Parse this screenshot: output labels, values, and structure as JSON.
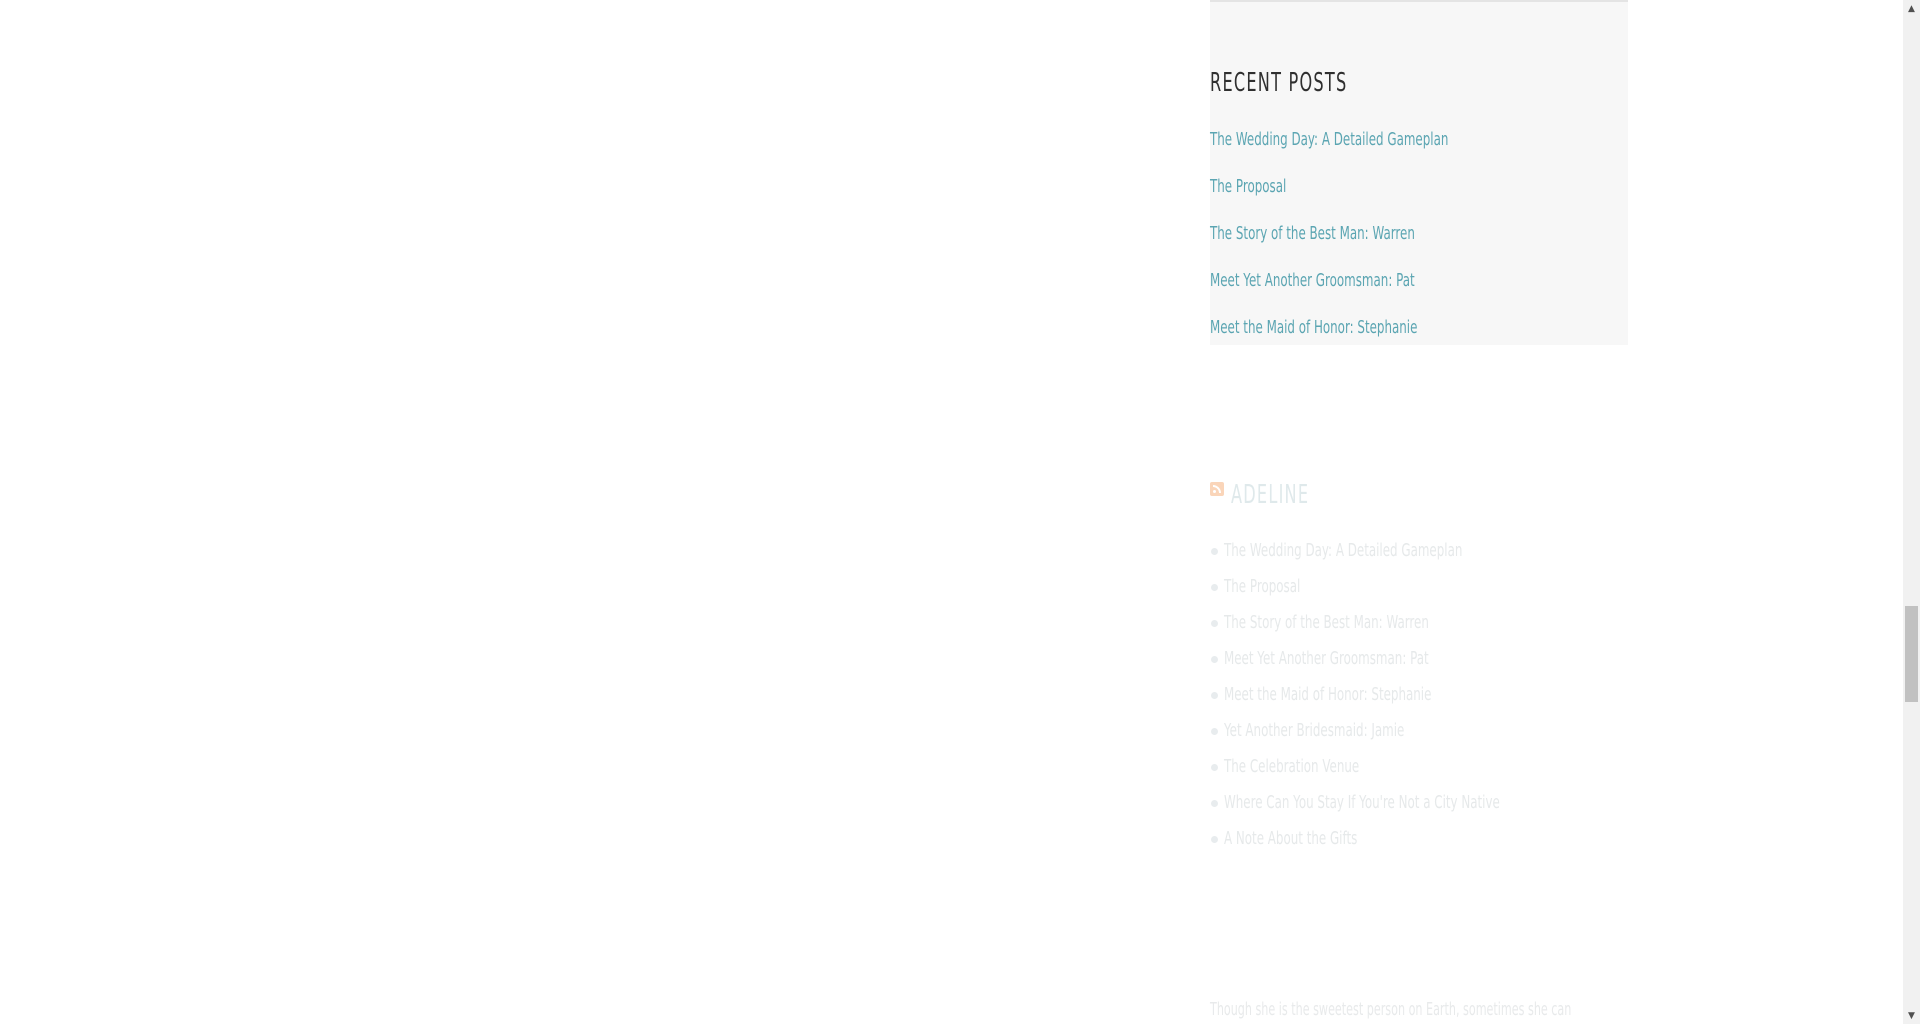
{
  "sidebar": {
    "recent_posts": {
      "title": "RECENT POSTS",
      "items": [
        {
          "label": "The Wedding Day: A Detailed Gameplan"
        },
        {
          "label": "The Proposal"
        },
        {
          "label": "The Story of the Best Man: Warren"
        },
        {
          "label": "Meet Yet Another Groomsman: Pat"
        },
        {
          "label": "Meet the Maid of Honor: Stephanie"
        }
      ]
    },
    "rss": {
      "icon": "rss-icon",
      "title": "ADELINE",
      "items": [
        {
          "label": "The Wedding Day: A Detailed Gameplan"
        },
        {
          "label": "The Proposal"
        },
        {
          "label": "The Story of the Best Man: Warren"
        },
        {
          "label": "Meet Yet Another Groomsman: Pat"
        },
        {
          "label": "Meet the Maid of Honor: Stephanie"
        },
        {
          "label": "Yet Another Bridesmaid: Jamie"
        },
        {
          "label": "The Celebration Venue"
        },
        {
          "label": "Where Can You Stay If You're Not a City Native"
        },
        {
          "label": "A Note About the Gifts"
        }
      ]
    },
    "about": {
      "text": "Though she is the sweetest person on Earth, sometimes she can"
    }
  },
  "colors": {
    "link": "#5ba5b2",
    "heading": "#2f2f2f",
    "widget_bg": "#f7f7f7",
    "faded_text": "#e6e9ea"
  },
  "scrollbar": {
    "up_arrow": "▲",
    "down_arrow": "▼"
  }
}
